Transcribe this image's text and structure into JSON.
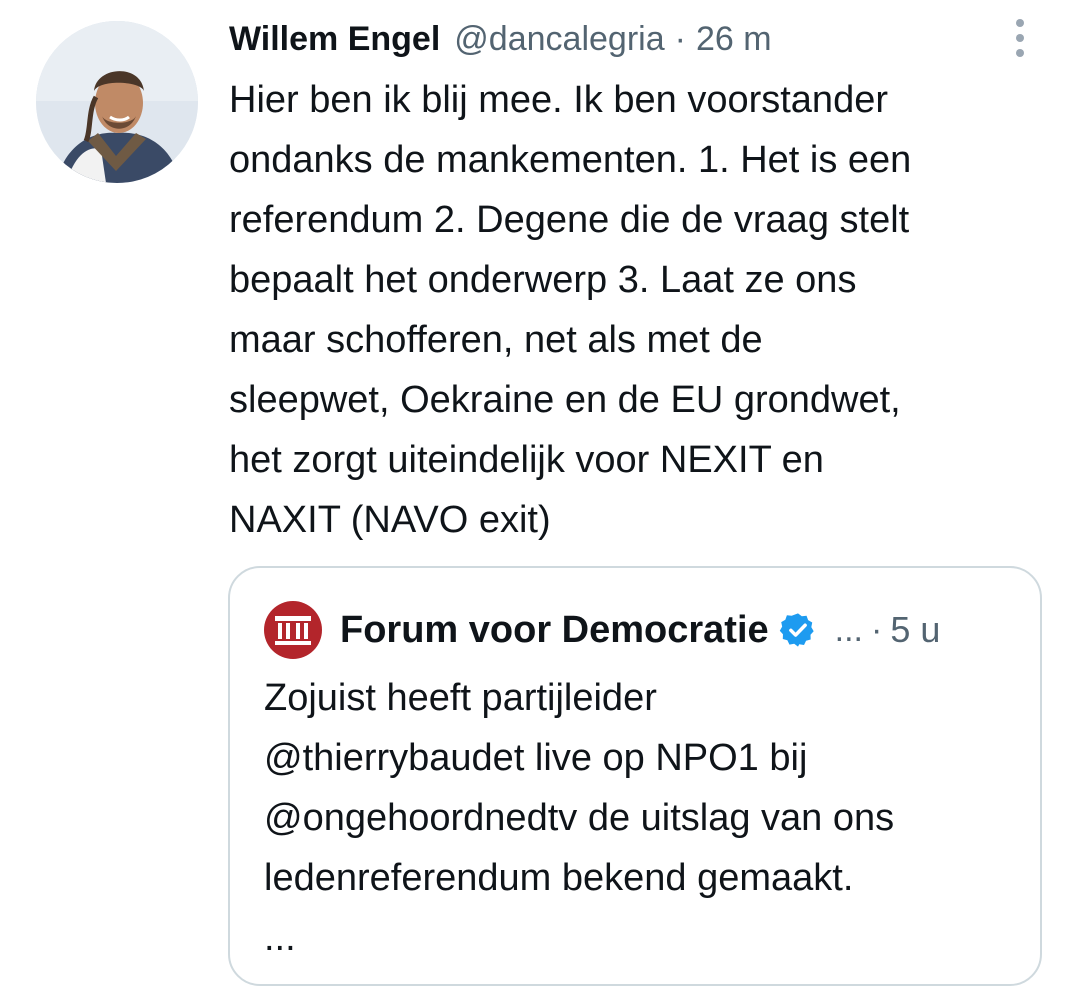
{
  "tweet": {
    "author": {
      "display_name": "Willem Engel",
      "handle": "@dancalegria",
      "separator": "·",
      "time": "26 m"
    },
    "text_lines": [
      "Hier ben ik blij mee. Ik ben voorstander",
      "ondanks de mankementen. 1. Het is een",
      "referendum 2. Degene die de vraag stelt",
      "bepaalt het onderwerp 3. Laat ze ons",
      "maar schofferen, net als met de",
      "sleepwet, Oekraine en de EU grondwet,",
      "het zorgt uiteindelijk voor NEXIT en",
      "NAXIT (NAVO exit)"
    ],
    "more_icon": "more-vertical-icon"
  },
  "quote": {
    "author": {
      "display_name": "Forum voor Democratie",
      "handle_truncated": "...",
      "separator": "·",
      "time": "5 u"
    },
    "text_lines": [
      "Zojuist heeft partijleider",
      "@thierrybaudet live op NPO1 bij",
      "@ongehoordnedtv de uitslag van ons",
      "ledenreferendum bekend gemaakt.",
      "..."
    ]
  },
  "colors": {
    "text": "#0f1419",
    "secondary": "#536471",
    "border": "#cfd9de",
    "verified": "#1d9bf0",
    "fvd_red": "#b3252b"
  }
}
